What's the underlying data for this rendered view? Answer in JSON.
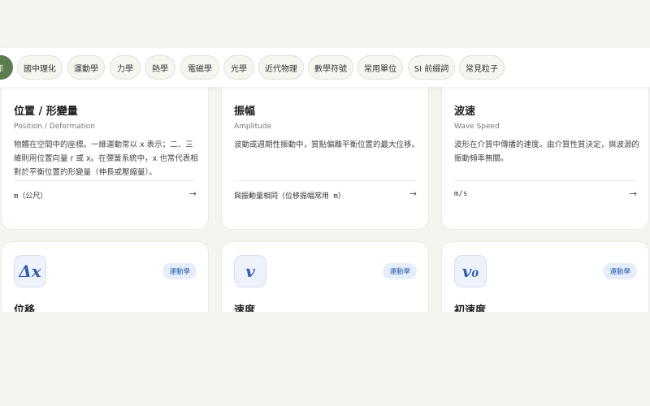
{
  "colors": {
    "background": "#f5f4ef",
    "accent": "#5c7b4f",
    "badge_bg": "#e7eefb",
    "badge_text": "#2e5db0"
  },
  "filters": [
    {
      "label": "全部",
      "active": true
    },
    {
      "label": "國中理化",
      "active": false
    },
    {
      "label": "運動學",
      "active": false
    },
    {
      "label": "力學",
      "active": false
    },
    {
      "label": "熱學",
      "active": false
    },
    {
      "label": "電磁學",
      "active": false
    },
    {
      "label": "光學",
      "active": false
    },
    {
      "label": "近代物理",
      "active": false
    },
    {
      "label": "數學符號",
      "active": false
    },
    {
      "label": "常用單位",
      "active": false
    },
    {
      "label": "SI 前綴詞",
      "active": false
    },
    {
      "label": "常見粒子",
      "active": false
    }
  ],
  "cards_row1": [
    {
      "title": "位置 / 形變量",
      "subtitle": "Position / Deformation",
      "desc": "物體在空間中的座標。一維運動常以 x 表示；二、三維則用位置向量 r 或 x。在彈簧系統中，x 也常代表相對於平衡位置的形變量（伸長或壓縮量）。",
      "unit": "m（公尺）",
      "arrow": "→"
    },
    {
      "title": "振幅",
      "subtitle": "Amplitude",
      "desc": "波動或週期性振動中，質點偏離平衡位置的最大位移。",
      "unit": "與振動量相同（位移振幅常用 m）",
      "arrow": "→"
    },
    {
      "title": "波速",
      "subtitle": "Wave Speed",
      "desc": "波形在介質中傳播的速度。由介質性質決定，與波源的振動頻率無關。",
      "unit": "m/s",
      "arrow": "→"
    }
  ],
  "cards_row2": [
    {
      "symbol": "Δx",
      "badge": "運動學",
      "title": "位移"
    },
    {
      "symbol": "v",
      "badge": "運動學",
      "title": "速度"
    },
    {
      "symbol": "v₀",
      "badge": "運動學",
      "title": "初速度"
    }
  ]
}
